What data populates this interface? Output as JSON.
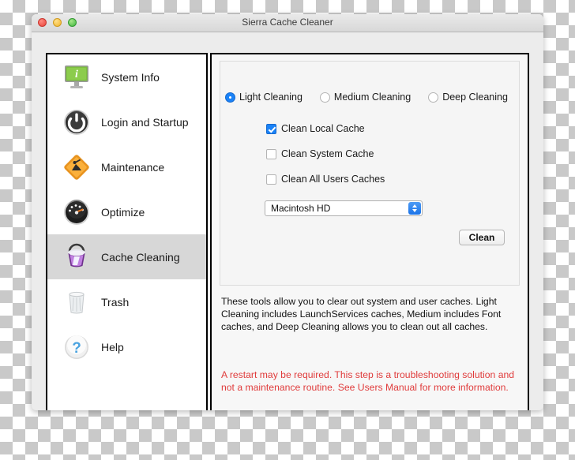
{
  "window": {
    "title": "Sierra Cache Cleaner",
    "traffic_lights": [
      "close-button",
      "minimize-button",
      "zoom-button"
    ]
  },
  "sidebar": {
    "items": [
      {
        "label": "System Info",
        "icon": "monitor-info-icon",
        "selected": false
      },
      {
        "label": "Login and Startup",
        "icon": "power-button-icon",
        "selected": false
      },
      {
        "label": "Maintenance",
        "icon": "roadwork-sign-icon",
        "selected": false
      },
      {
        "label": "Optimize",
        "icon": "speedometer-icon",
        "selected": false
      },
      {
        "label": "Cache Cleaning",
        "icon": "cache-bucket-icon",
        "selected": true
      },
      {
        "label": "Trash",
        "icon": "trash-can-icon",
        "selected": false
      },
      {
        "label": "Help",
        "icon": "question-mark-icon",
        "selected": false
      }
    ]
  },
  "main": {
    "cleaning_modes": [
      {
        "label": "Light Cleaning",
        "selected": true
      },
      {
        "label": "Medium Cleaning",
        "selected": false
      },
      {
        "label": "Deep Cleaning",
        "selected": false
      }
    ],
    "checkboxes": [
      {
        "label": "Clean Local Cache",
        "checked": true
      },
      {
        "label": "Clean System Cache",
        "checked": false
      },
      {
        "label": "Clean All Users Caches",
        "checked": false
      }
    ],
    "volume": {
      "selected": "Macintosh HD"
    },
    "clean_button_label": "Clean",
    "description": "These tools allow you to clear out system and user caches.  Light Cleaning includes LaunchServices caches, Medium includes Font caches, and Deep Cleaning allows you to clean out all caches.",
    "warning": "A restart may be required.  This step is a troubleshooting solution and not a maintenance routine.  See Users Manual for more information."
  },
  "colors": {
    "accent_blue": "#1a82f7",
    "warning_red": "#e03c3c",
    "selected_row": "#d7d7d7"
  }
}
